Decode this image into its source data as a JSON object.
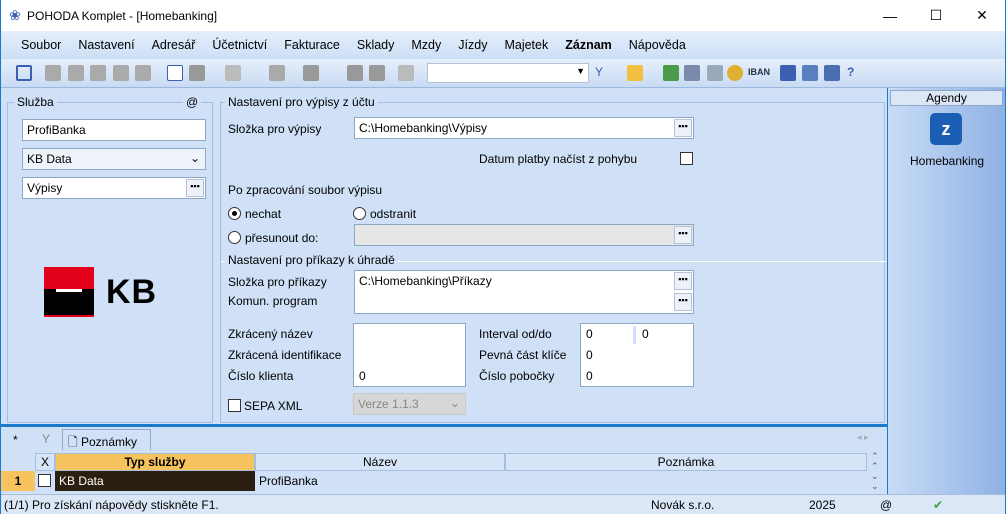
{
  "window": {
    "title": "POHODA Komplet - [Homebanking]",
    "min": "—",
    "max": "☐",
    "close": "✕"
  },
  "menu": [
    "Soubor",
    "Nastavení",
    "Adresář",
    "Účetnictví",
    "Fakturace",
    "Sklady",
    "Mzdy",
    "Jízdy",
    "Majetek",
    "Záznam",
    "Nápověda"
  ],
  "toolbar": {
    "iban": "IBAN",
    "search_value": ""
  },
  "sluzba": {
    "title": "Služba",
    "at": "@",
    "name": "ProfiBanka",
    "type": "KB Data",
    "mode": "Výpisy",
    "logo_text": "KB"
  },
  "vypisy": {
    "title": "Nastavení pro výpisy z účtu",
    "folder_label": "Složka pro výpisy",
    "folder": "C:\\Homebanking\\Výpisy",
    "date_label": "Datum platby načíst z pohybu",
    "after_label": "Po zpracování soubor výpisu",
    "opt_keep": "nechat",
    "opt_delete": "odstranit",
    "opt_move": "přesunout do:",
    "move_path": ""
  },
  "prikazy": {
    "title": "Nastavení pro příkazy k úhradě",
    "folder_label": "Složka pro příkazy",
    "folder": "C:\\Homebanking\\Příkazy",
    "program_label": "Komun. program",
    "program": "",
    "short_name_label": "Zkrácený název",
    "short_id_label": "Zkrácená identifikace",
    "client_label": "Číslo klienta",
    "client": "0",
    "interval_label": "Interval od/do",
    "interval_from": "0",
    "interval_to": "0",
    "key_label": "Pevná část klíče",
    "key": "0",
    "branch_label": "Číslo pobočky",
    "branch": "0",
    "sepa_label": "SEPA XML",
    "sepa_version": "Verze 1.1.3"
  },
  "agendy": {
    "title": "Agendy",
    "items": [
      {
        "label": "Homebanking"
      }
    ]
  },
  "tabs": {
    "star": "*",
    "notes": "Poznámky"
  },
  "table": {
    "columns": [
      "X",
      "Typ služby",
      "Název",
      "Poznámka"
    ],
    "rows": [
      {
        "num": "1",
        "type": "KB Data",
        "name": "ProfiBanka",
        "note": ""
      }
    ]
  },
  "status": {
    "help": "(1/1) Pro získání nápovědy stiskněte F1.",
    "company": "Novák s.r.o.",
    "year": "2025",
    "at": "@"
  }
}
